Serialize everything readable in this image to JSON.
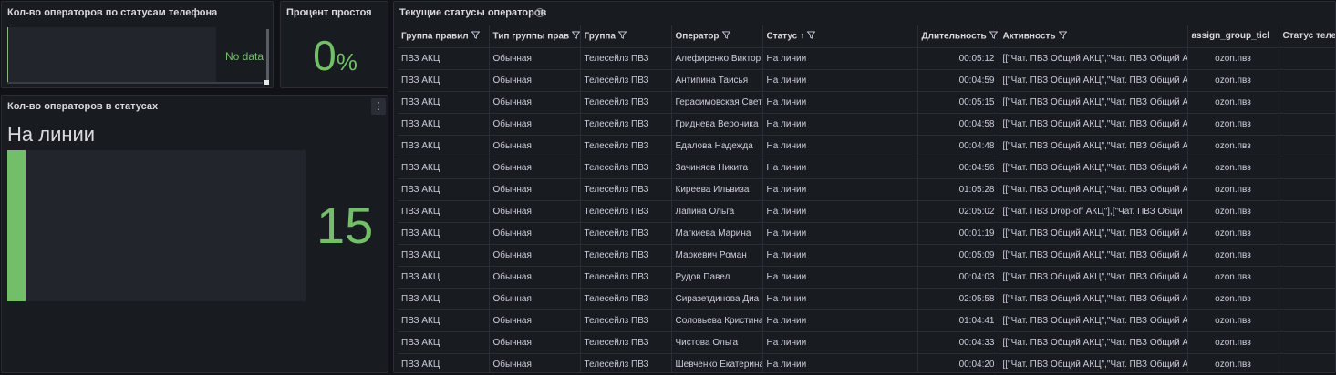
{
  "panels": {
    "phone_status": {
      "title": "Кол-во операторов по статусам телефона",
      "no_data": "No data"
    },
    "idle_percent": {
      "title": "Процент простоя",
      "value": "0",
      "unit": "%"
    },
    "statuses": {
      "title": "Кол-во операторов в статусах",
      "bar_label": "На линии",
      "bar_value": "15",
      "bar_fill_fraction": 0.06
    },
    "table": {
      "title": "Текущие статусы операторов",
      "columns": [
        "Группа правил",
        "Тип группы прав",
        "Группа",
        "Оператор",
        "Статус",
        "Длительность",
        "Активность",
        "assign_group_ticl",
        "Статус теле"
      ],
      "rows": [
        [
          "ПВЗ АКЦ",
          "Обычная",
          "Телесейлз ПВЗ",
          "Алефиренко Виктор",
          "На линии",
          "00:05:12",
          "[[\"Чат. ПВЗ Общий АКЦ\",\"Чат. ПВЗ Общий А",
          "ozon.пвз",
          ""
        ],
        [
          "ПВЗ АКЦ",
          "Обычная",
          "Телесейлз ПВЗ",
          "Антипина Таисья",
          "На линии",
          "00:04:59",
          "[[\"Чат. ПВЗ Общий АКЦ\",\"Чат. ПВЗ Общий А",
          "ozon.пвз",
          ""
        ],
        [
          "ПВЗ АКЦ",
          "Обычная",
          "Телесейлз ПВЗ",
          "Герасимовская Свет",
          "На линии",
          "00:05:15",
          "[[\"Чат. ПВЗ Общий АКЦ\",\"Чат. ПВЗ Общий А",
          "ozon.пвз",
          ""
        ],
        [
          "ПВЗ АКЦ",
          "Обычная",
          "Телесейлз ПВЗ",
          "Гриднева Вероника",
          "На линии",
          "00:04:58",
          "[[\"Чат. ПВЗ Общий АКЦ\",\"Чат. ПВЗ Общий А",
          "ozon.пвз",
          ""
        ],
        [
          "ПВЗ АКЦ",
          "Обычная",
          "Телесейлз ПВЗ",
          "Едалова Надежда",
          "На линии",
          "00:04:48",
          "[[\"Чат. ПВЗ Общий АКЦ\",\"Чат. ПВЗ Общий А",
          "ozon.пвз",
          ""
        ],
        [
          "ПВЗ АКЦ",
          "Обычная",
          "Телесейлз ПВЗ",
          "Зачиняев Никита",
          "На линии",
          "00:04:56",
          "[[\"Чат. ПВЗ Общий АКЦ\",\"Чат. ПВЗ Общий А",
          "ozon.пвз",
          ""
        ],
        [
          "ПВЗ АКЦ",
          "Обычная",
          "Телесейлз ПВЗ",
          "Киреева Ильвиза",
          "На линии",
          "01:05:28",
          "[[\"Чат. ПВЗ Общий АКЦ\",\"Чат. ПВЗ Общий А",
          "ozon.пвз",
          ""
        ],
        [
          "ПВЗ АКЦ",
          "Обычная",
          "Телесейлз ПВЗ",
          "Лапина Ольга",
          "На линии",
          "02:05:02",
          "[[\"Чат. ПВЗ Drop-off АКЦ\"],[\"Чат. ПВЗ Общи",
          "ozon.пвз",
          ""
        ],
        [
          "ПВЗ АКЦ",
          "Обычная",
          "Телесейлз ПВЗ",
          "Магкиева Марина",
          "На линии",
          "00:01:19",
          "[[\"Чат. ПВЗ Общий АКЦ\",\"Чат. ПВЗ Общий А",
          "ozon.пвз",
          ""
        ],
        [
          "ПВЗ АКЦ",
          "Обычная",
          "Телесейлз ПВЗ",
          "Маркевич Роман",
          "На линии",
          "00:05:09",
          "[[\"Чат. ПВЗ Общий АКЦ\",\"Чат. ПВЗ Общий А",
          "ozon.пвз",
          ""
        ],
        [
          "ПВЗ АКЦ",
          "Обычная",
          "Телесейлз ПВЗ",
          "Рудов Павел",
          "На линии",
          "00:04:03",
          "[[\"Чат. ПВЗ Общий АКЦ\",\"Чат. ПВЗ Общий А",
          "ozon.пвз",
          ""
        ],
        [
          "ПВЗ АКЦ",
          "Обычная",
          "Телесейлз ПВЗ",
          "Сиразетдинова Диа",
          "На линии",
          "02:05:58",
          "[[\"Чат. ПВЗ Общий АКЦ\",\"Чат. ПВЗ Общий А",
          "ozon.пвз",
          ""
        ],
        [
          "ПВЗ АКЦ",
          "Обычная",
          "Телесейлз ПВЗ",
          "Соловьева Кристина",
          "На линии",
          "01:04:41",
          "[[\"Чат. ПВЗ Общий АКЦ\",\"Чат. ПВЗ Общий А",
          "ozon.пвз",
          ""
        ],
        [
          "ПВЗ АКЦ",
          "Обычная",
          "Телесейлз ПВЗ",
          "Чистова Ольга",
          "На линии",
          "00:04:33",
          "[[\"Чат. ПВЗ Общий АКЦ\",\"Чат. ПВЗ Общий А",
          "ozon.пвз",
          ""
        ],
        [
          "ПВЗ АКЦ",
          "Обычная",
          "Телесейлз ПВЗ",
          "Шевченко Екатерина",
          "На линии",
          "00:04:20",
          "[[\"Чат. ПВЗ Общий АКЦ\",\"Чат. ПВЗ Общий А",
          "ozon.пвз",
          ""
        ]
      ]
    }
  },
  "colors": {
    "accent_green": "#73bf69",
    "panel_bg": "#181b1f",
    "page_bg": "#111217"
  }
}
